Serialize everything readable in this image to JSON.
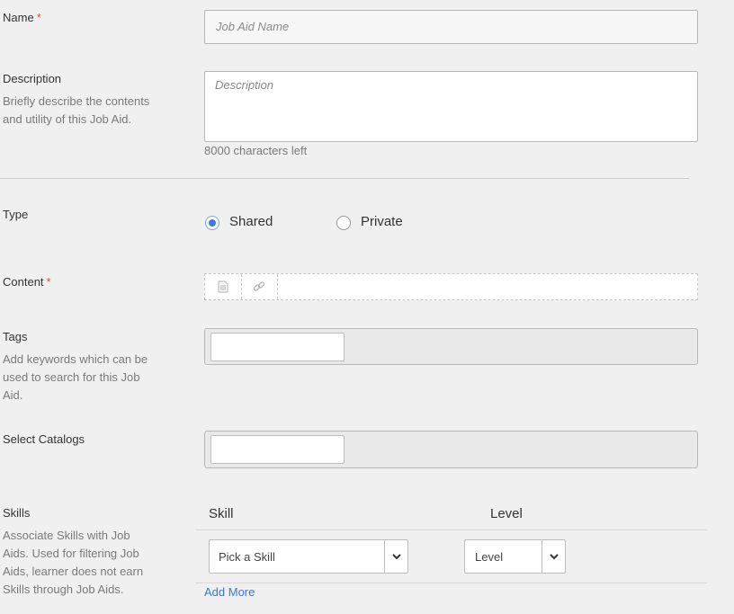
{
  "form": {
    "name": {
      "label": "Name",
      "required_mark": "*",
      "placeholder": "Job Aid Name",
      "value": ""
    },
    "description": {
      "label": "Description",
      "help": "Briefly describe the contents and utility of this Job Aid.",
      "placeholder": "Description",
      "value": "",
      "chars_left": "8000 characters left"
    },
    "type": {
      "label": "Type",
      "options": [
        {
          "label": "Shared",
          "checked": true
        },
        {
          "label": "Private",
          "checked": false
        }
      ]
    },
    "content": {
      "label": "Content",
      "required_mark": "*",
      "icons": [
        "document-icon",
        "link-icon"
      ]
    },
    "tags": {
      "label": "Tags",
      "help": "Add keywords which can be used to search for this Job Aid.",
      "value": ""
    },
    "catalogs": {
      "label": "Select Catalogs",
      "value": ""
    },
    "skills": {
      "label": "Skills",
      "help": "Associate Skills with Job Aids. Used for filtering Job Aids, learner does not earn Skills through Job Aids.",
      "col_skill": "Skill",
      "col_level": "Level",
      "skill_select": "Pick a Skill",
      "level_select": "Level",
      "add_more": "Add More"
    }
  },
  "colors": {
    "accent": "#3b7dd8",
    "required": "#d9534f",
    "link": "#3a78c3"
  }
}
